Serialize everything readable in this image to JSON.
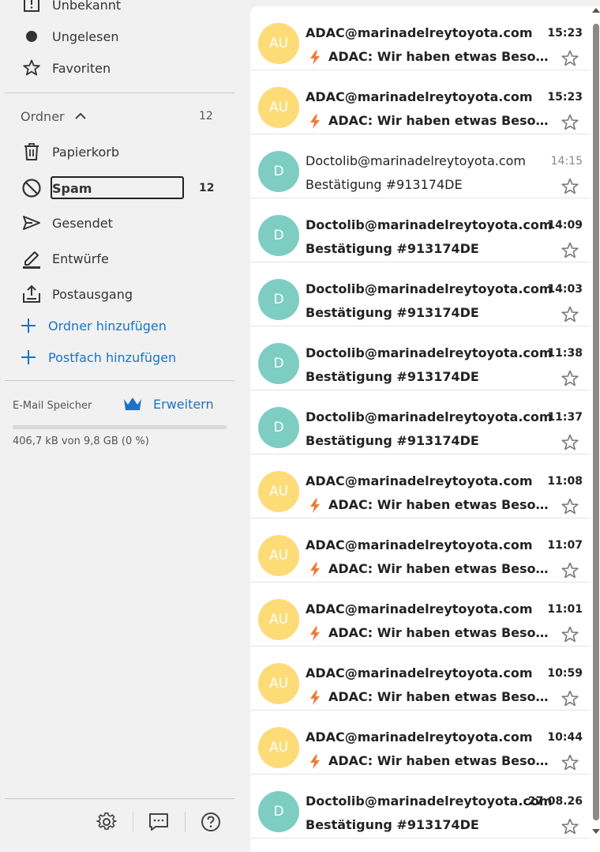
{
  "sidebar": {
    "views": [
      {
        "label": "Unbekannt",
        "icon": "unknown-icon"
      },
      {
        "label": "Ungelesen",
        "icon": "dot-icon"
      },
      {
        "label": "Favoriten",
        "icon": "star-icon"
      }
    ],
    "folders_header": {
      "label": "Ordner",
      "count": "12"
    },
    "folders": [
      {
        "label": "Papierkorb",
        "icon": "trash-icon",
        "count": ""
      },
      {
        "label": "Spam",
        "icon": "block-icon",
        "count": "12"
      },
      {
        "label": "Gesendet",
        "icon": "send-icon",
        "count": ""
      },
      {
        "label": "Entwürfe",
        "icon": "pencil-icon",
        "count": ""
      },
      {
        "label": "Postausgang",
        "icon": "outbox-icon",
        "count": ""
      }
    ],
    "add_folder": "Ordner hinzufügen",
    "add_mailbox": "Postfach hinzufügen",
    "storage": {
      "label": "E-Mail Speicher",
      "upgrade": "Erweitern",
      "usage": "406,7 kB von 9,8 GB (0 %)",
      "percent": 0
    },
    "bottom_icons": [
      "settings-icon",
      "feedback-icon",
      "help-icon"
    ]
  },
  "colors": {
    "accent": "#1a73c8",
    "avatar_yellow": "#fddb77",
    "avatar_teal": "#7ecdc3",
    "bolt": "#f07a3c"
  },
  "emails": [
    {
      "avatar": "AU",
      "sender": "ADAC@marinadelreytoyota.com",
      "time": "15:23",
      "subject": "ADAC: Wir haben etwas Besonderes für Sie",
      "bolt": true,
      "unread": true
    },
    {
      "avatar": "AU",
      "sender": "ADAC@marinadelreytoyota.com",
      "time": "15:23",
      "subject": "ADAC: Wir haben etwas Besonderes für Sie",
      "bolt": true,
      "unread": true
    },
    {
      "avatar": "D",
      "sender": "Doctolib@marinadelreytoyota.com",
      "time": "14:15",
      "subject": "Bestätigung #913174DE",
      "bolt": false,
      "unread": false
    },
    {
      "avatar": "D",
      "sender": "Doctolib@marinadelreytoyota.com",
      "time": "14:09",
      "subject": "Bestätigung #913174DE",
      "bolt": false,
      "unread": true
    },
    {
      "avatar": "D",
      "sender": "Doctolib@marinadelreytoyota.com",
      "time": "14:03",
      "subject": "Bestätigung #913174DE",
      "bolt": false,
      "unread": true
    },
    {
      "avatar": "D",
      "sender": "Doctolib@marinadelreytoyota.com",
      "time": "11:38",
      "subject": "Bestätigung #913174DE",
      "bolt": false,
      "unread": true
    },
    {
      "avatar": "D",
      "sender": "Doctolib@marinadelreytoyota.com",
      "time": "11:37",
      "subject": "Bestätigung #913174DE",
      "bolt": false,
      "unread": true
    },
    {
      "avatar": "AU",
      "sender": "ADAC@marinadelreytoyota.com",
      "time": "11:08",
      "subject": "ADAC: Wir haben etwas Besonderes für Sie",
      "bolt": true,
      "unread": true
    },
    {
      "avatar": "AU",
      "sender": "ADAC@marinadelreytoyota.com",
      "time": "11:07",
      "subject": "ADAC: Wir haben etwas Besonderes für Sie",
      "bolt": true,
      "unread": true
    },
    {
      "avatar": "AU",
      "sender": "ADAC@marinadelreytoyota.com",
      "time": "11:01",
      "subject": "ADAC: Wir haben etwas Besonderes für Sie",
      "bolt": true,
      "unread": true
    },
    {
      "avatar": "AU",
      "sender": "ADAC@marinadelreytoyota.com",
      "time": "10:59",
      "subject": "ADAC: Wir haben etwas Besonderes für Sie",
      "bolt": true,
      "unread": true
    },
    {
      "avatar": "AU",
      "sender": "ADAC@marinadelreytoyota.com",
      "time": "10:44",
      "subject": "ADAC: Wir haben etwas Besonderes für Sie",
      "bolt": true,
      "unread": true
    },
    {
      "avatar": "D",
      "sender": "Doctolib@marinadelreytoyota.com",
      "time": "27.08.26",
      "subject": "Bestätigung #913174DE",
      "bolt": false,
      "unread": true
    }
  ]
}
